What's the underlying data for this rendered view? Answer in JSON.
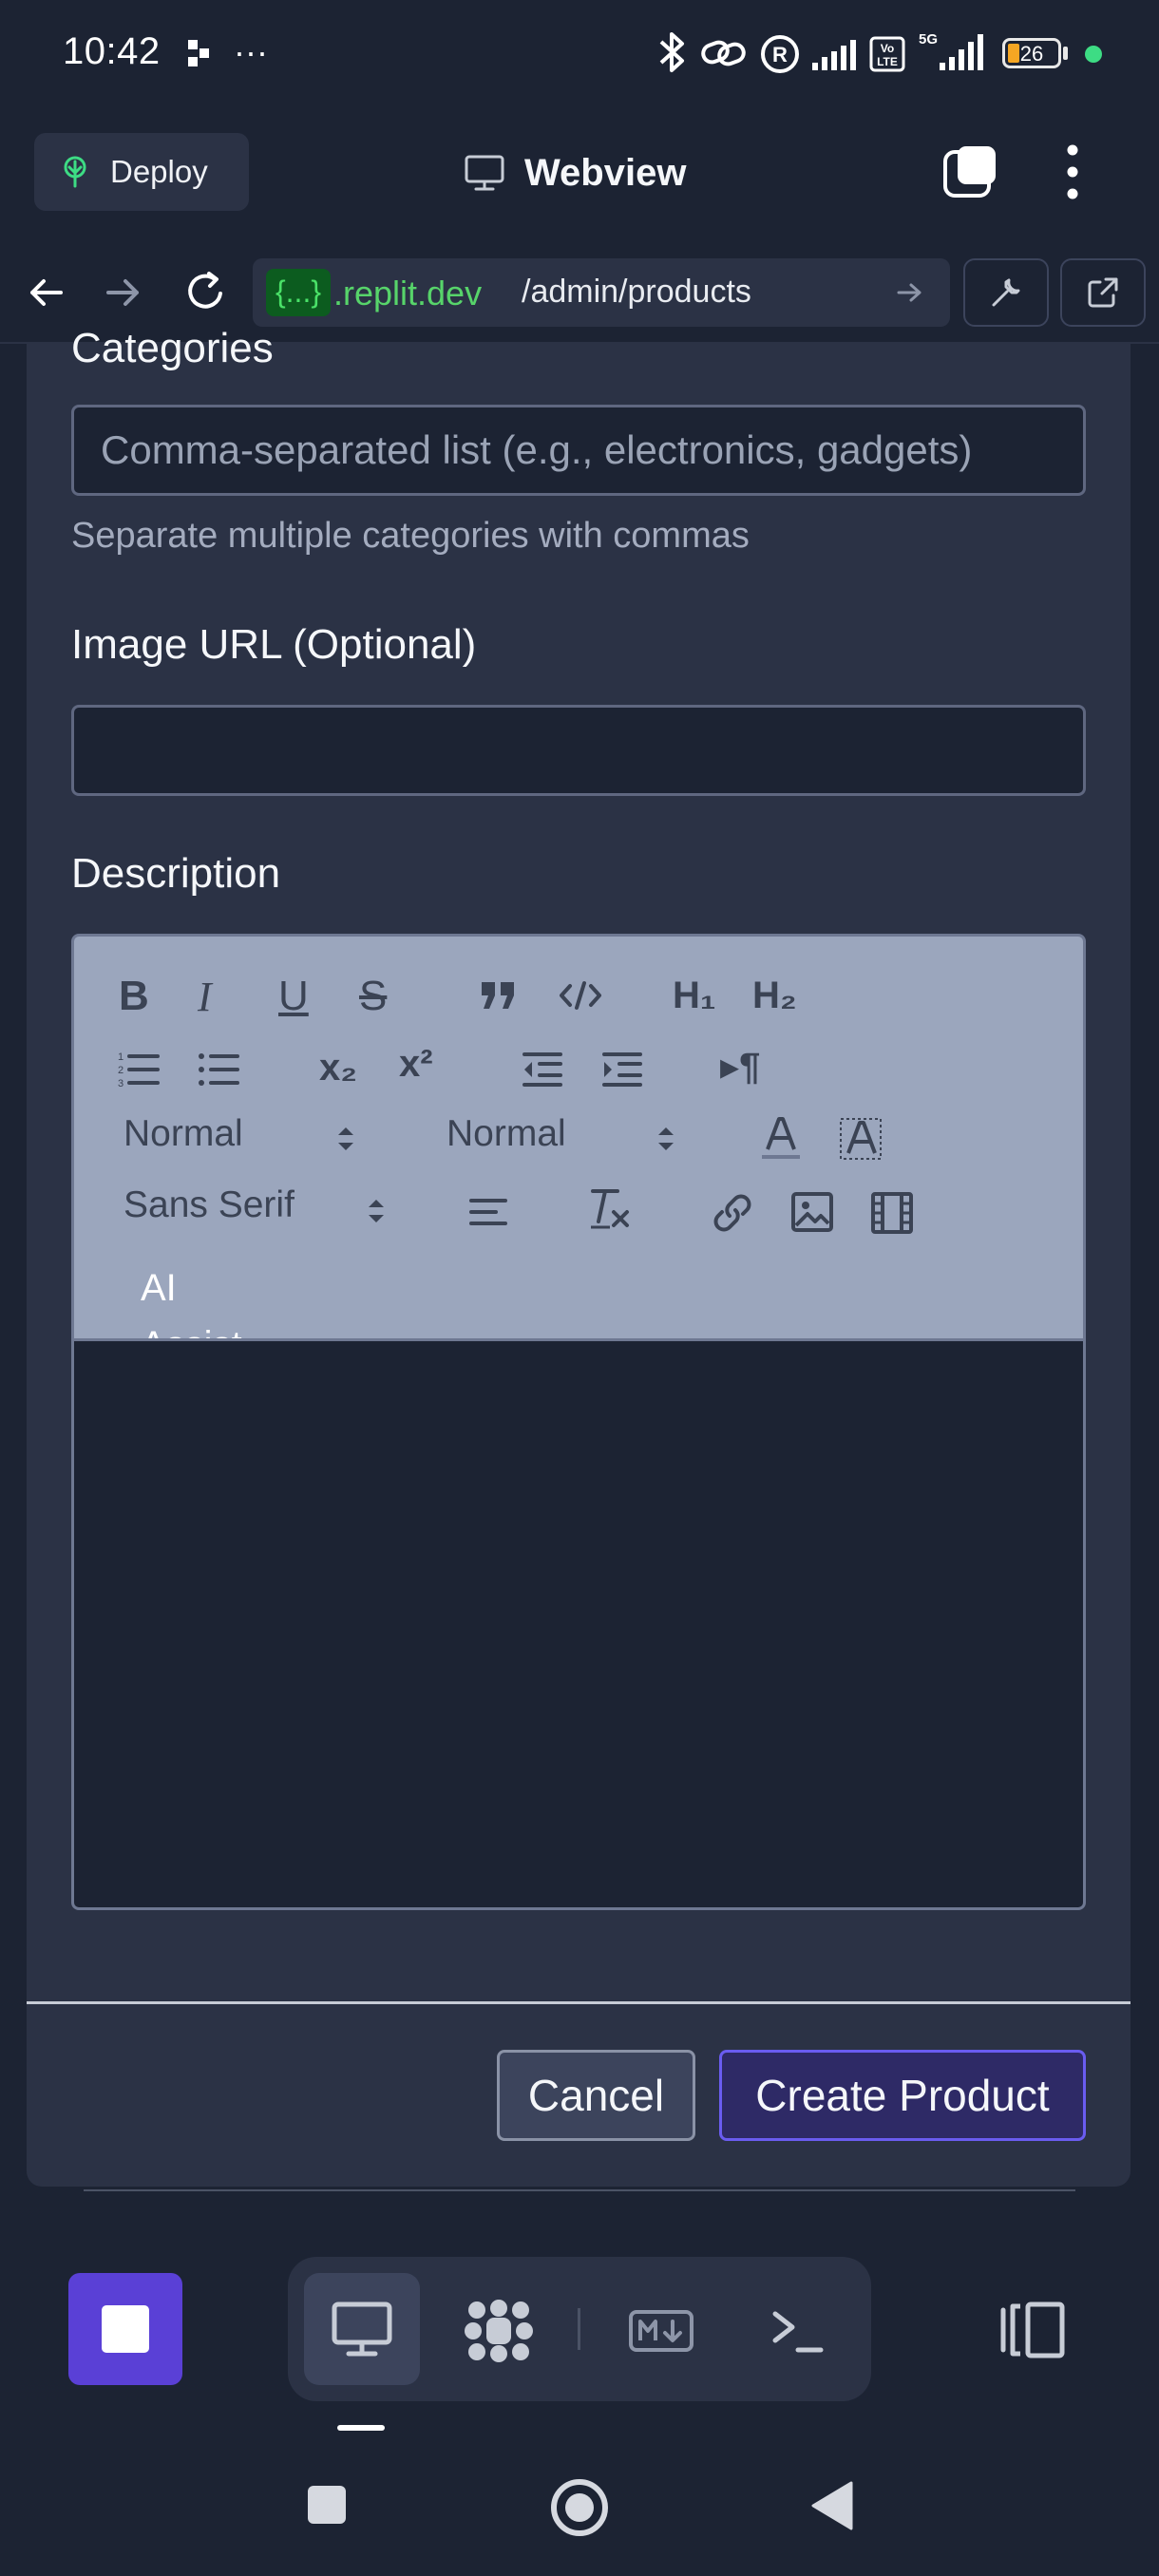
{
  "status_bar": {
    "time": "10:42",
    "overflow": "···",
    "battery": "26",
    "network": "5G",
    "icons": [
      "notification-icon",
      "bluetooth-icon",
      "link-icon",
      "registered-icon",
      "signal-icon",
      "volte-icon",
      "signal-5g-icon",
      "battery-icon",
      "active-dot"
    ]
  },
  "header": {
    "deploy_label": "Deploy",
    "title": "Webview"
  },
  "url_bar": {
    "token": "{...}",
    "domain": ".replit.dev",
    "path": "/admin/products"
  },
  "form": {
    "categories": {
      "label": "Categories",
      "placeholder": "Comma-separated list (e.g., electronics, gadgets)",
      "value": "",
      "help": "Separate multiple categories with commas"
    },
    "image_url": {
      "label": "Image URL (Optional)",
      "value": ""
    },
    "description": {
      "label": "Description",
      "toolbar": {
        "bold": "B",
        "italic": "I",
        "underline": "U",
        "strike": "S",
        "blockquote": "99",
        "code": "</>",
        "h1": "H₁",
        "h2": "H₂",
        "subscript": "x₂",
        "superscript": "x²",
        "rtl": "▸¶",
        "size_select": "Normal",
        "header_select": "Normal",
        "font_select": "Sans Serif",
        "ai_assist": "AI Assist"
      },
      "value": ""
    },
    "cancel_label": "Cancel",
    "create_label": "Create Product"
  },
  "colors": {
    "background": "#1c2333",
    "surface": "#2b3245",
    "accent": "#5a40d6",
    "primary_border": "#6a5cf0",
    "url_green": "#57d46a"
  }
}
